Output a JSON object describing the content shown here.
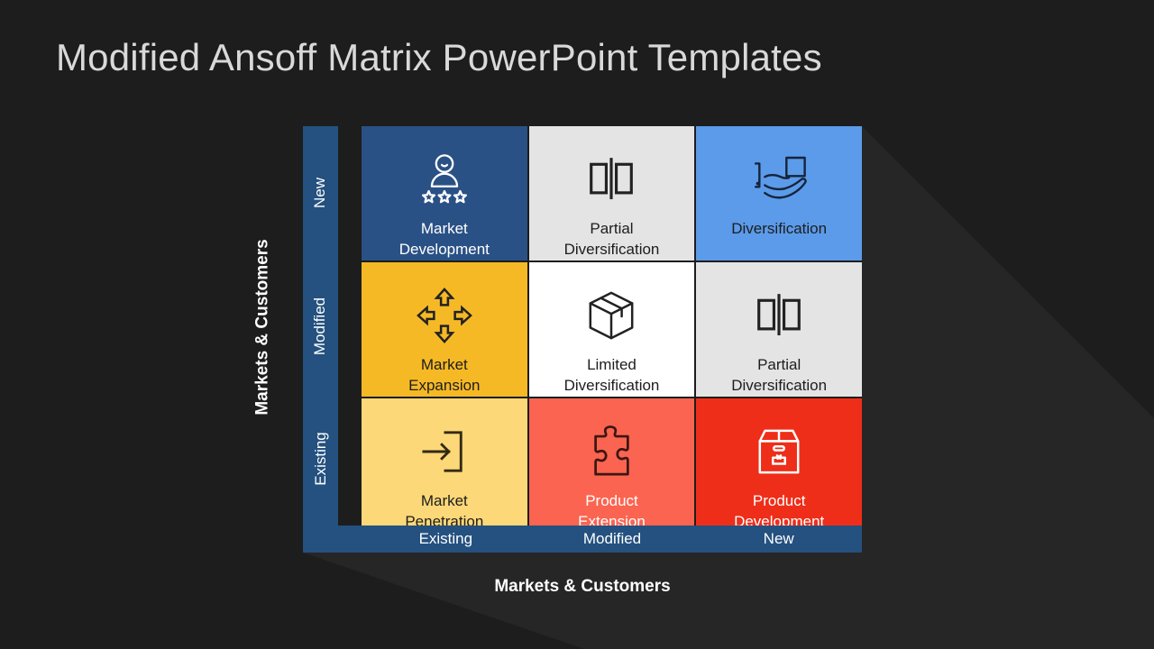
{
  "slide": {
    "title": "Modified Ansoff Matrix PowerPoint Templates",
    "background_color": "#1d1d1d",
    "title_color": "#d9d9d9"
  },
  "axes": {
    "vertical": {
      "caption": "Markets & Customers",
      "labels": [
        "New",
        "Modified",
        "Existing"
      ],
      "band_color": "#24517f"
    },
    "horizontal": {
      "caption": "Markets & Customers",
      "labels": [
        "Existing",
        "Modified",
        "New"
      ],
      "band_color": "#24517f"
    }
  },
  "matrix": {
    "cells": [
      {
        "id": "market-development",
        "label": "Market\nDevelopment",
        "icon": "person-three-stars-icon",
        "bg": "#2a5185",
        "text_color": "#ffffff",
        "row": "New",
        "column": "Existing"
      },
      {
        "id": "partial-diversification-top",
        "label": "Partial\nDiversification",
        "icon": "split-rectangles-icon",
        "bg": "#e4e4e4",
        "text_color": "#1d1d1d",
        "row": "New",
        "column": "Modified"
      },
      {
        "id": "diversification",
        "label": "Diversification",
        "icon": "hand-holding-box-icon",
        "bg": "#5b9bea",
        "text_color": "#1d1d1d",
        "row": "New",
        "column": "New"
      },
      {
        "id": "market-expansion",
        "label": "Market\nExpansion",
        "icon": "four-direction-arrows-icon",
        "bg": "#f6b926",
        "text_color": "#1d1d1d",
        "row": "Modified",
        "column": "Existing"
      },
      {
        "id": "limited-diversification",
        "label": "Limited\nDiversification",
        "icon": "cube-box-icon",
        "bg": "#ffffff",
        "text_color": "#1d1d1d",
        "row": "Modified",
        "column": "Modified"
      },
      {
        "id": "partial-diversification-right",
        "label": "Partial\nDiversification",
        "icon": "split-rectangles-icon",
        "bg": "#e4e4e4",
        "text_color": "#1d1d1d",
        "row": "Modified",
        "column": "New"
      },
      {
        "id": "market-penetration",
        "label": "Market\nPenetration",
        "icon": "arrow-into-box-icon",
        "bg": "#fcd878",
        "text_color": "#1d1d1d",
        "row": "Existing",
        "column": "Existing"
      },
      {
        "id": "product-extension",
        "label": "Product\nExtension",
        "icon": "puzzle-piece-icon",
        "bg": "#fb6450",
        "text_color": "#ffffff",
        "row": "Existing",
        "column": "Modified"
      },
      {
        "id": "product-development",
        "label": "Product\nDevelopment",
        "icon": "package-carton-icon",
        "bg": "#ee2e19",
        "text_color": "#ffffff",
        "row": "Existing",
        "column": "New"
      }
    ]
  }
}
